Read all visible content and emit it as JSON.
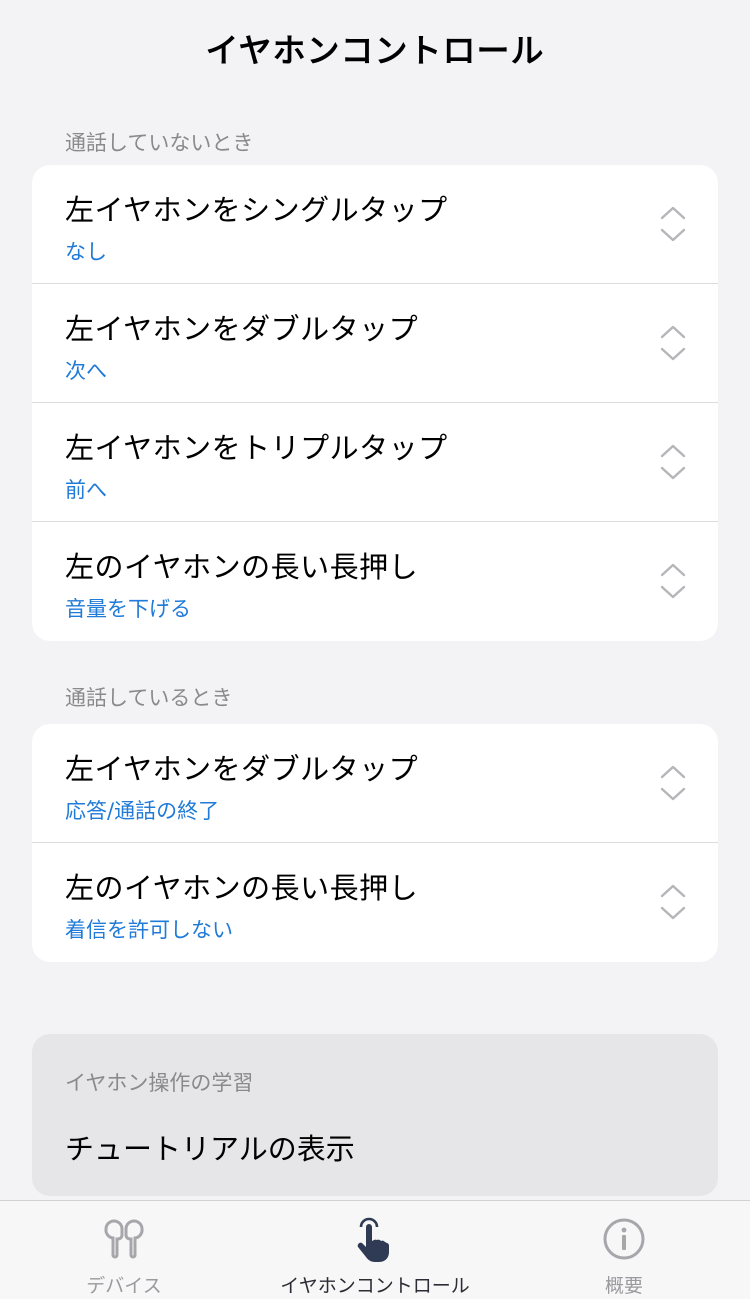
{
  "header": {
    "title": "イヤホンコントロール"
  },
  "sections": [
    {
      "label": "通話していないとき",
      "rows": [
        {
          "title": "左イヤホンをシングルタップ",
          "value": "なし"
        },
        {
          "title": "左イヤホンをダブルタップ",
          "value": "次へ"
        },
        {
          "title": "左イヤホンをトリプルタップ",
          "value": "前へ"
        },
        {
          "title": "左のイヤホンの長い長押し",
          "value": "音量を下げる"
        }
      ]
    },
    {
      "label": "通話しているとき",
      "rows": [
        {
          "title": "左イヤホンをダブルタップ",
          "value": "応答/通話の終了"
        },
        {
          "title": "左のイヤホンの長い長押し",
          "value": "着信を許可しない"
        }
      ]
    }
  ],
  "learning": {
    "label": "イヤホン操作の学習",
    "link": "チュートリアルの表示"
  },
  "tabbar": {
    "tabs": [
      {
        "label": "デバイス",
        "icon": "earbuds-icon",
        "active": false
      },
      {
        "label": "イヤホンコントロール",
        "icon": "tap-hand-icon",
        "active": true
      },
      {
        "label": "概要",
        "icon": "info-icon",
        "active": false
      }
    ]
  },
  "colors": {
    "accent": "#1f7ad8",
    "background": "#f3f3f5",
    "secondary_text": "#8a8a8e"
  }
}
